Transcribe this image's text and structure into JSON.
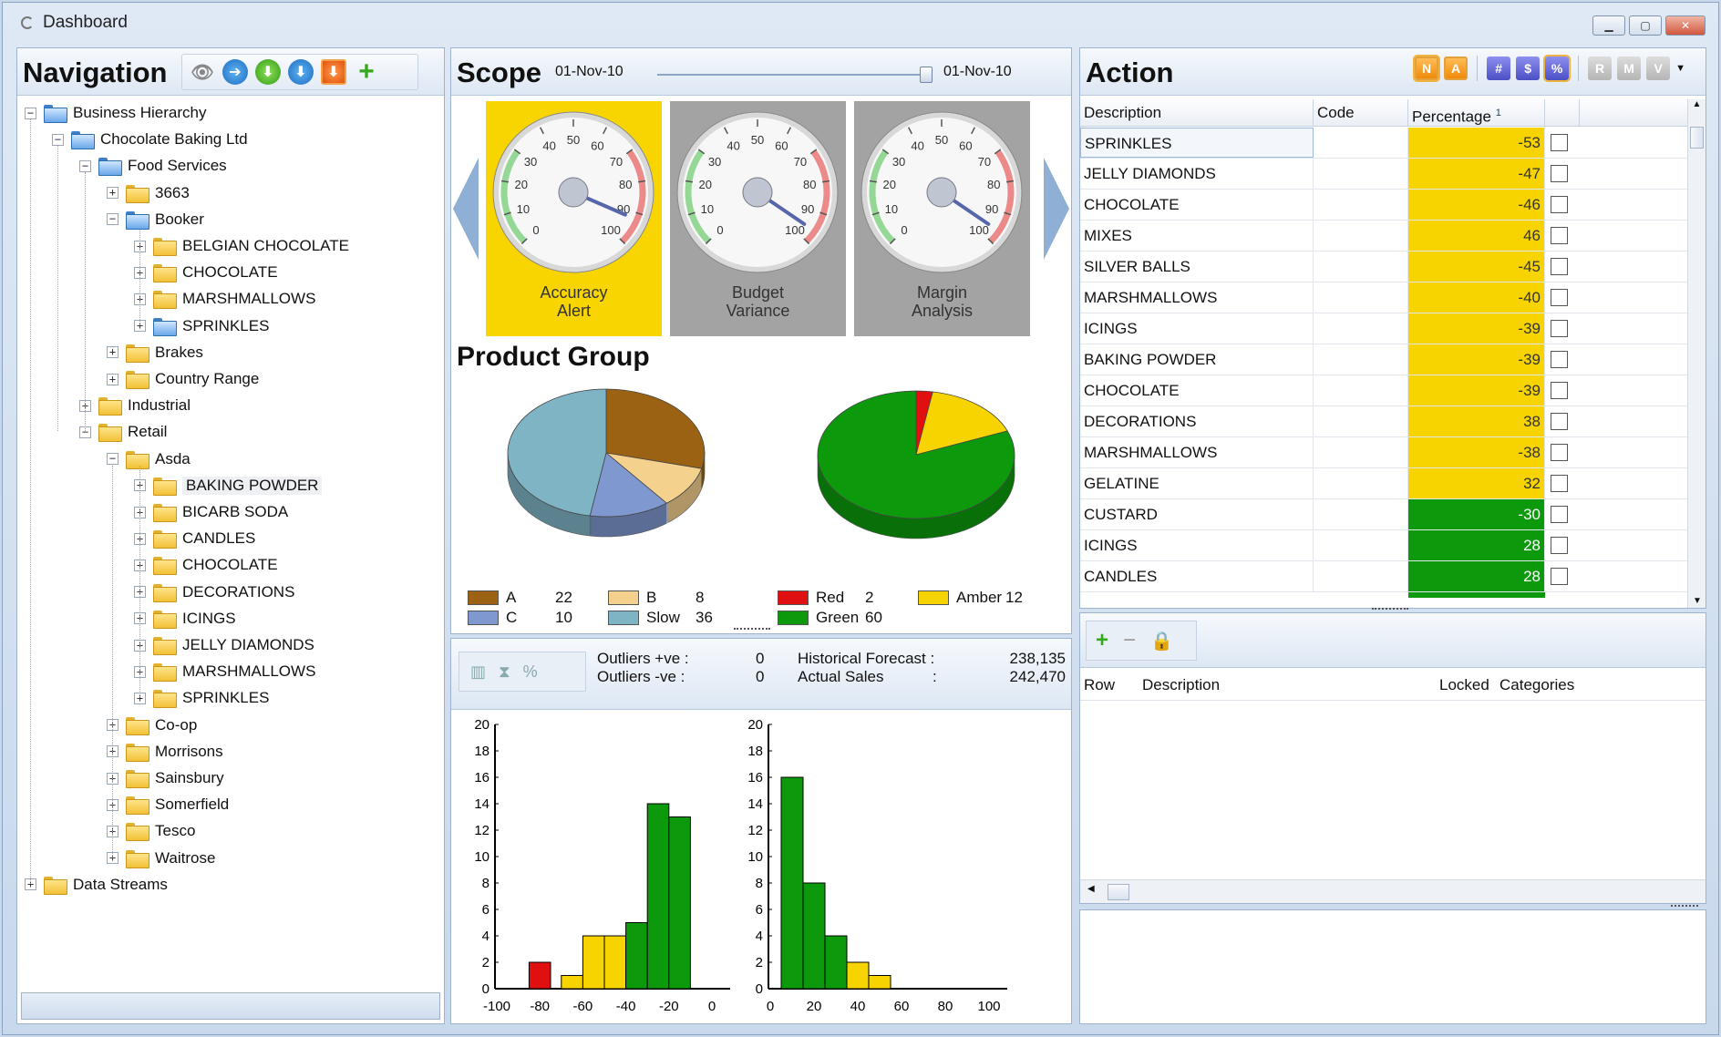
{
  "window": {
    "title": "Dashboard"
  },
  "navigation": {
    "title": "Navigation",
    "tree": [
      {
        "label": "Business Hierarchy",
        "level": 0,
        "expander": "-",
        "folder": "blue"
      },
      {
        "label": "Chocolate Baking Ltd",
        "level": 1,
        "expander": "-",
        "folder": "blue"
      },
      {
        "label": "Food Services",
        "level": 2,
        "expander": "-",
        "folder": "blue"
      },
      {
        "label": "3663",
        "level": 3,
        "expander": "+",
        "folder": "yellow"
      },
      {
        "label": "Booker",
        "level": 3,
        "expander": "-",
        "folder": "blue"
      },
      {
        "label": "BELGIAN CHOCOLATE",
        "level": 4,
        "expander": "+",
        "folder": "yellow"
      },
      {
        "label": "CHOCOLATE",
        "level": 4,
        "expander": "+",
        "folder": "yellow"
      },
      {
        "label": "MARSHMALLOWS",
        "level": 4,
        "expander": "+",
        "folder": "yellow"
      },
      {
        "label": "SPRINKLES",
        "level": 4,
        "expander": "+",
        "folder": "blue"
      },
      {
        "label": "Brakes",
        "level": 3,
        "expander": "+",
        "folder": "yellow"
      },
      {
        "label": "Country Range",
        "level": 3,
        "expander": "+",
        "folder": "yellow"
      },
      {
        "label": "Industrial",
        "level": 2,
        "expander": "+",
        "folder": "yellow"
      },
      {
        "label": "Retail",
        "level": 2,
        "expander": "-",
        "folder": "yellow"
      },
      {
        "label": "Asda",
        "level": 3,
        "expander": "-",
        "folder": "yellow"
      },
      {
        "label": "BAKING POWDER",
        "level": 4,
        "expander": "+",
        "folder": "yellow",
        "selected": true
      },
      {
        "label": "BICARB SODA",
        "level": 4,
        "expander": "+",
        "folder": "yellow"
      },
      {
        "label": "CANDLES",
        "level": 4,
        "expander": "+",
        "folder": "yellow"
      },
      {
        "label": "CHOCOLATE",
        "level": 4,
        "expander": "+",
        "folder": "yellow"
      },
      {
        "label": "DECORATIONS",
        "level": 4,
        "expander": "+",
        "folder": "yellow"
      },
      {
        "label": "ICINGS",
        "level": 4,
        "expander": "+",
        "folder": "yellow"
      },
      {
        "label": "JELLY DIAMONDS",
        "level": 4,
        "expander": "+",
        "folder": "yellow"
      },
      {
        "label": "MARSHMALLOWS",
        "level": 4,
        "expander": "+",
        "folder": "yellow"
      },
      {
        "label": "SPRINKLES",
        "level": 4,
        "expander": "+",
        "folder": "yellow"
      },
      {
        "label": "Co-op",
        "level": 3,
        "expander": "+",
        "folder": "yellow"
      },
      {
        "label": "Morrisons",
        "level": 3,
        "expander": "+",
        "folder": "yellow"
      },
      {
        "label": "Sainsbury",
        "level": 3,
        "expander": "+",
        "folder": "yellow"
      },
      {
        "label": "Somerfield",
        "level": 3,
        "expander": "+",
        "folder": "yellow"
      },
      {
        "label": "Tesco",
        "level": 3,
        "expander": "+",
        "folder": "yellow"
      },
      {
        "label": "Waitrose",
        "level": 3,
        "expander": "+",
        "folder": "yellow"
      },
      {
        "label": "Data Streams",
        "level": 0,
        "expander": "+",
        "folder": "yellow"
      }
    ]
  },
  "scope": {
    "title": "Scope",
    "date_from": "01-Nov-10",
    "date_to": "01-Nov-10",
    "gauges": [
      {
        "label_line1": "Accuracy",
        "label_line2": "Alert",
        "value": 92,
        "style": "yellow"
      },
      {
        "label_line1": "Budget",
        "label_line2": "Variance",
        "value": 96,
        "style": "gray"
      },
      {
        "label_line1": "Margin",
        "label_line2": "Analysis",
        "value": 96,
        "style": "gray"
      }
    ],
    "gauge_ticks": [
      "0",
      "10",
      "20",
      "30",
      "40",
      "50",
      "60",
      "70",
      "80",
      "90",
      "100"
    ]
  },
  "product_group": {
    "title": "Product Group",
    "pie_left": [
      {
        "name": "A",
        "value": 22,
        "color": "#9a6212"
      },
      {
        "name": "B",
        "value": 8,
        "color": "#f5d18e"
      },
      {
        "name": "C",
        "value": 10,
        "color": "#7f98cf"
      },
      {
        "name": "Slow",
        "value": 36,
        "color": "#7fb4c5"
      }
    ],
    "pie_right": [
      {
        "name": "Red",
        "value": 2,
        "color": "#e01010"
      },
      {
        "name": "Amber",
        "value": 12,
        "color": "#f7d400"
      },
      {
        "name": "Green",
        "value": 60,
        "color": "#0c9a0c"
      }
    ]
  },
  "histogram": {
    "outliers_pos_label": "Outliers +ve :",
    "outliers_pos": "0",
    "outliers_neg_label": "Outliers -ve  :",
    "outliers_neg": "0",
    "hist_forecast_label": "Historical Forecast :",
    "hist_forecast": "238,135",
    "actual_sales_label": "Actual Sales",
    "actual_sales_colon": ":",
    "actual_sales": "242,470"
  },
  "chart_data": [
    {
      "type": "bar",
      "x_ticks": [
        "-100",
        "-80",
        "-60",
        "-40",
        "-20",
        "0"
      ],
      "y_ticks": [
        "0",
        "2",
        "4",
        "6",
        "8",
        "10",
        "12",
        "14",
        "16",
        "18",
        "20"
      ],
      "xlim": [
        -100,
        0
      ],
      "ylim": [
        0,
        20
      ],
      "bins": [
        {
          "x": -80,
          "value": 2,
          "color": "#e01010"
        },
        {
          "x": -65,
          "value": 1,
          "color": "#f7d400"
        },
        {
          "x": -55,
          "value": 4,
          "color": "#f7d400"
        },
        {
          "x": -45,
          "value": 4,
          "color": "#f7d400"
        },
        {
          "x": -35,
          "value": 5,
          "color": "#0c9a0c"
        },
        {
          "x": -25,
          "value": 14,
          "color": "#0c9a0c"
        },
        {
          "x": -15,
          "value": 13,
          "color": "#0c9a0c"
        }
      ]
    },
    {
      "type": "bar",
      "x_ticks": [
        "0",
        "20",
        "40",
        "60",
        "80",
        "100"
      ],
      "y_ticks": [
        "0",
        "2",
        "4",
        "6",
        "8",
        "10",
        "12",
        "14",
        "16",
        "18",
        "20"
      ],
      "xlim": [
        0,
        100
      ],
      "ylim": [
        0,
        20
      ],
      "bins": [
        {
          "x": 10,
          "value": 16,
          "color": "#0c9a0c"
        },
        {
          "x": 20,
          "value": 8,
          "color": "#0c9a0c"
        },
        {
          "x": 30,
          "value": 4,
          "color": "#0c9a0c"
        },
        {
          "x": 40,
          "value": 2,
          "color": "#f7d400"
        },
        {
          "x": 50,
          "value": 1,
          "color": "#f7d400"
        }
      ]
    }
  ],
  "action": {
    "title": "Action",
    "toolbar": [
      "N",
      "A",
      "#",
      "$",
      "%",
      "R",
      "M",
      "V"
    ],
    "columns": {
      "description": "Description",
      "code": "Code",
      "percentage": "Percentage",
      "sort_mark": "1"
    },
    "rows": [
      {
        "description": "SPRINKLES",
        "code": "",
        "pct": "-53",
        "band": "amber"
      },
      {
        "description": "JELLY DIAMONDS",
        "code": "",
        "pct": "-47",
        "band": "amber"
      },
      {
        "description": "CHOCOLATE",
        "code": "",
        "pct": "-46",
        "band": "amber"
      },
      {
        "description": "MIXES",
        "code": "",
        "pct": "46",
        "band": "amber"
      },
      {
        "description": "SILVER BALLS",
        "code": "",
        "pct": "-45",
        "band": "amber"
      },
      {
        "description": "MARSHMALLOWS",
        "code": "",
        "pct": "-40",
        "band": "amber"
      },
      {
        "description": "ICINGS",
        "code": "",
        "pct": "-39",
        "band": "amber"
      },
      {
        "description": "BAKING POWDER",
        "code": "",
        "pct": "-39",
        "band": "amber"
      },
      {
        "description": "CHOCOLATE",
        "code": "",
        "pct": "-39",
        "band": "amber"
      },
      {
        "description": "DECORATIONS",
        "code": "",
        "pct": "38",
        "band": "amber"
      },
      {
        "description": "MARSHMALLOWS",
        "code": "",
        "pct": "-38",
        "band": "amber"
      },
      {
        "description": "GELATINE",
        "code": "",
        "pct": "32",
        "band": "amber"
      },
      {
        "description": "CUSTARD",
        "code": "",
        "pct": "-30",
        "band": "green"
      },
      {
        "description": "ICINGS",
        "code": "",
        "pct": "28",
        "band": "green"
      },
      {
        "description": "CANDLES",
        "code": "",
        "pct": "28",
        "band": "green"
      }
    ],
    "colors": {
      "amber": "#f7d400",
      "green": "#0c9a0c"
    }
  },
  "lower": {
    "columns": {
      "row": "Row",
      "description": "Description",
      "locked": "Locked",
      "categories": "Categories"
    }
  }
}
